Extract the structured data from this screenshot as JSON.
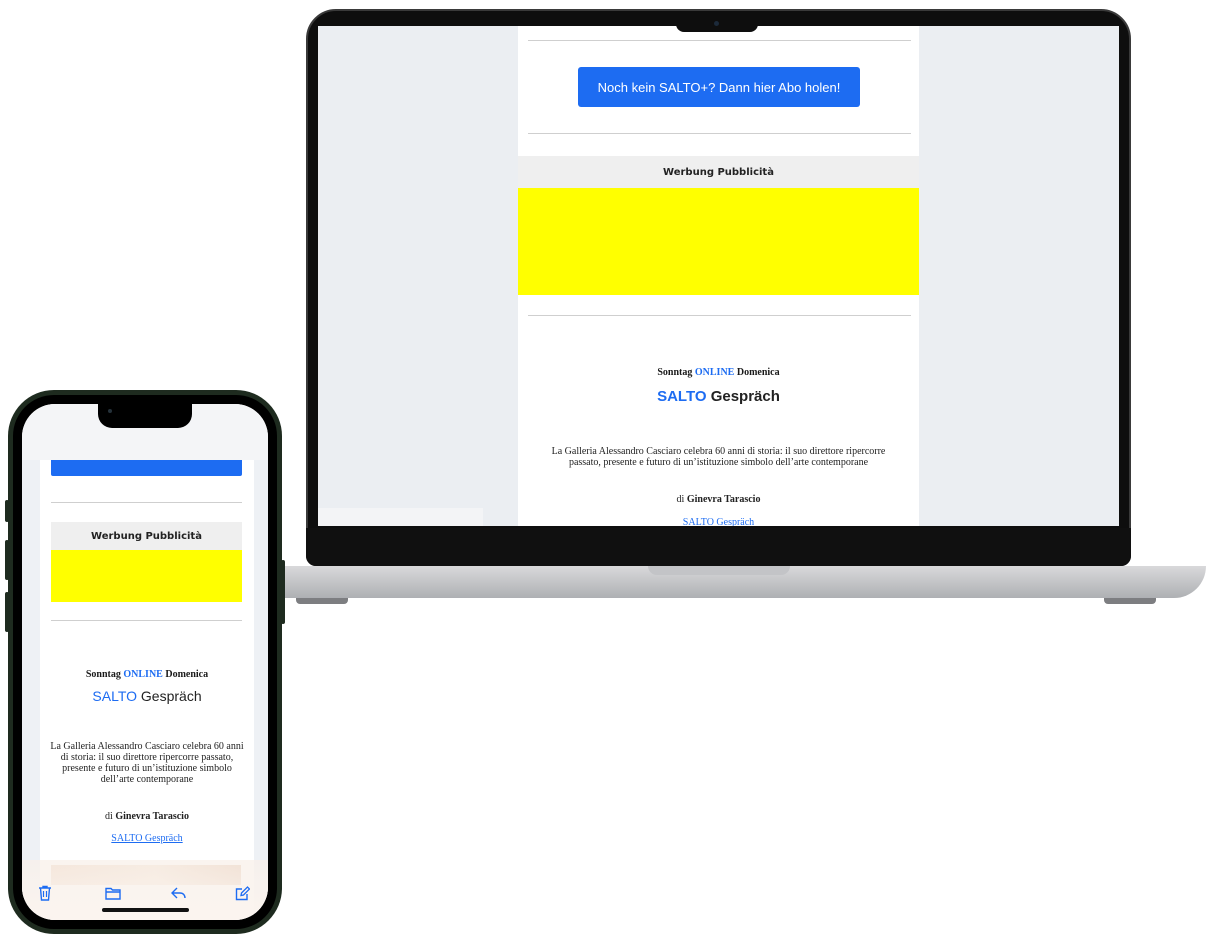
{
  "laptop_email": {
    "cta_label": "Noch kein SALTO+? Dann hier Abo holen!",
    "ad_label": "Werbung Pubblicità",
    "kicker_pre": "Sonntag",
    "kicker_mid": "ONLINE",
    "kicker_post": "Domenica",
    "heading_brand": "SALTO",
    "heading_rest": "Gespräch",
    "body": "La Galleria Alessandro Casciaro celebra 60 anni di storia: il suo direttore ripercorre passato, presente e futuro di un’istituzione simbolo dell’arte contemporane",
    "author_prefix": "di",
    "author_name": "Ginevra Tarascio",
    "link": "SALTO Gespräch"
  },
  "phone_email": {
    "ad_label": "Werbung Pubblicità",
    "kicker_pre": "Sonntag",
    "kicker_mid": "ONLINE",
    "kicker_post": "Domenica",
    "heading_brand": "SALTO",
    "heading_rest": "Gespräch",
    "body": "La Galleria Alessandro Casciaro celebra 60 anni di storia: il suo direttore ripercorre passato, presente e futuro di un’istituzione simbolo dell’arte contemporane",
    "author_prefix": "di",
    "author_name": "Ginevra Tarascio",
    "link": "SALTO Gespräch"
  },
  "phone_toolbar": {
    "icons": [
      "trash-icon",
      "folder-icon",
      "reply-icon",
      "compose-icon"
    ]
  },
  "colors": {
    "accent": "#1d6cf2",
    "ad_yellow": "#ffff00",
    "ad_label_bg": "#efefef"
  }
}
